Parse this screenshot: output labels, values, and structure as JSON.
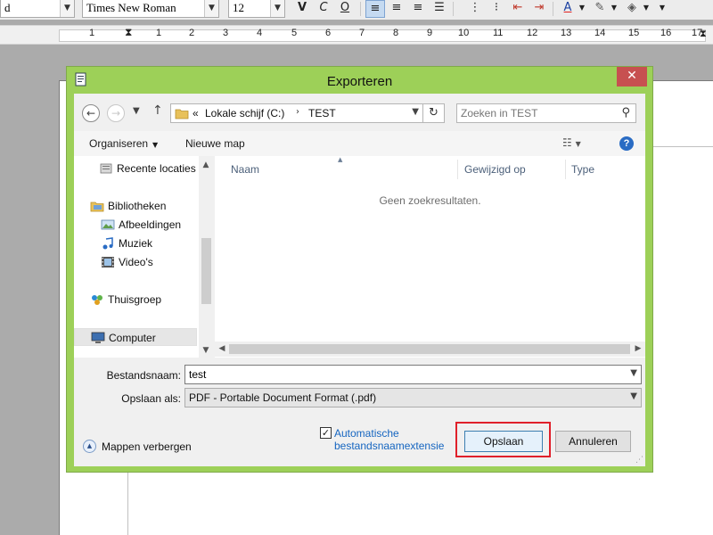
{
  "toolbar": {
    "style_value": "d",
    "font_value": "Times New Roman",
    "size_value": "12"
  },
  "ruler": {
    "numbers": [
      "1",
      "1",
      "2",
      "3",
      "4",
      "5",
      "6",
      "7",
      "8",
      "9",
      "10",
      "11",
      "12",
      "13",
      "14",
      "15",
      "16",
      "17"
    ]
  },
  "dialog": {
    "title": "Exporteren",
    "close_glyph": "✕",
    "address": {
      "prefix": "«",
      "crumb1": "Lokale schijf (C:)",
      "separator": "›",
      "crumb2": "TEST"
    },
    "search_placeholder": "Zoeken in TEST",
    "commands": {
      "organize": "Organiseren",
      "new_folder": "Nieuwe map"
    },
    "help_glyph": "?",
    "nav_items": [
      {
        "label": "Recente locaties",
        "icon": "recent-locations-icon"
      },
      {
        "label": "Bibliotheken",
        "icon": "libraries-icon"
      },
      {
        "label": "Afbeeldingen",
        "icon": "pictures-icon"
      },
      {
        "label": "Muziek",
        "icon": "music-icon"
      },
      {
        "label": "Video's",
        "icon": "videos-icon"
      },
      {
        "label": "Thuisgroep",
        "icon": "homegroup-icon"
      },
      {
        "label": "Computer",
        "icon": "computer-icon"
      }
    ],
    "columns": [
      "Naam",
      "Gewijzigd op",
      "Type"
    ],
    "empty_message": "Geen zoekresultaten.",
    "filename_label": "Bestandsnaam:",
    "filename_value": "test",
    "savetype_label": "Opslaan als:",
    "savetype_value": "PDF - Portable Document Format (.pdf)",
    "hide_folders": "Mappen verbergen",
    "auto_ext_line1": "Automatische",
    "auto_ext_line2": "bestandsnaamextensie",
    "save_button": "Opslaan",
    "cancel_button": "Annuleren"
  },
  "colors": {
    "frame": "#9dd058",
    "close": "#c75050",
    "highlight": "#e0202a",
    "link": "#1565c0"
  }
}
